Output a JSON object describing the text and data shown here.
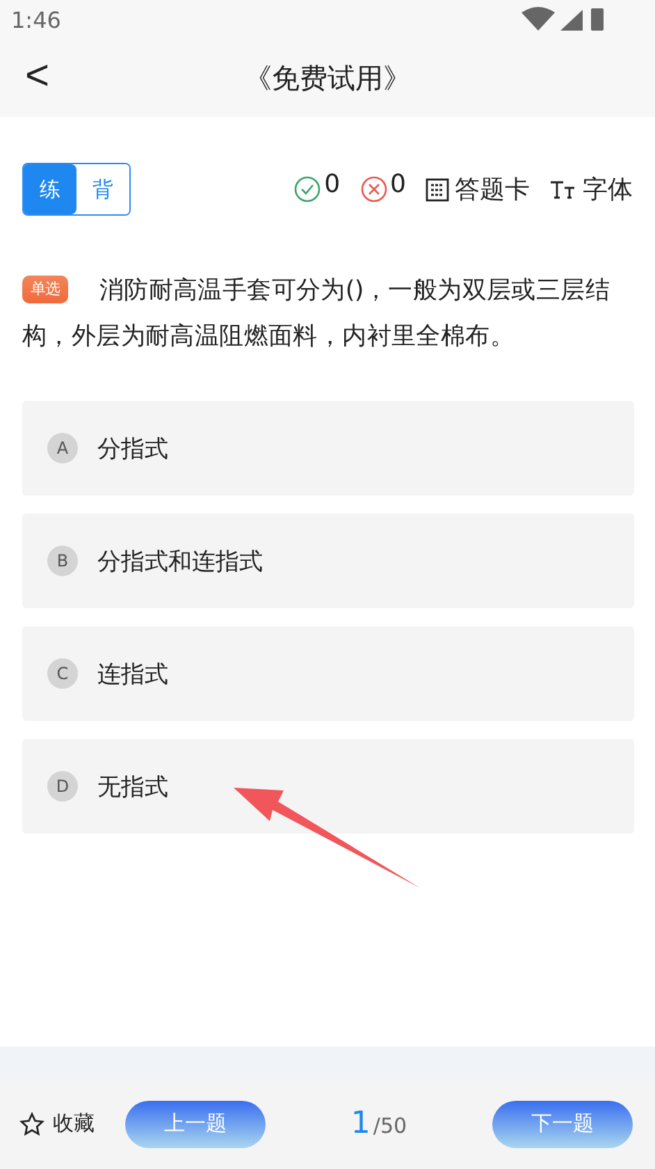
{
  "status_bar": {
    "time": "1:46"
  },
  "header": {
    "back": "<",
    "title": "《免费试用》"
  },
  "mode_toggle": [
    {
      "label": "练",
      "selected": true
    },
    {
      "label": "背",
      "selected": false
    }
  ],
  "stats": {
    "correct": "0",
    "wrong": "0",
    "answer_card": "答题卡",
    "font": "字体"
  },
  "question": {
    "tag": "单选",
    "text": "消防耐高温手套可分为()，一般为双层或三层结构，外层为耐高温阻燃面料，内衬里全棉布。"
  },
  "options": [
    {
      "letter": "A",
      "text": "分指式"
    },
    {
      "letter": "B",
      "text": "分指式和连指式"
    },
    {
      "letter": "C",
      "text": "连指式"
    },
    {
      "letter": "D",
      "text": "无指式"
    }
  ],
  "bottom_bar": {
    "favorite": "收藏",
    "prev": "上一题",
    "current": "1",
    "total": "/50",
    "next": "下一题"
  }
}
